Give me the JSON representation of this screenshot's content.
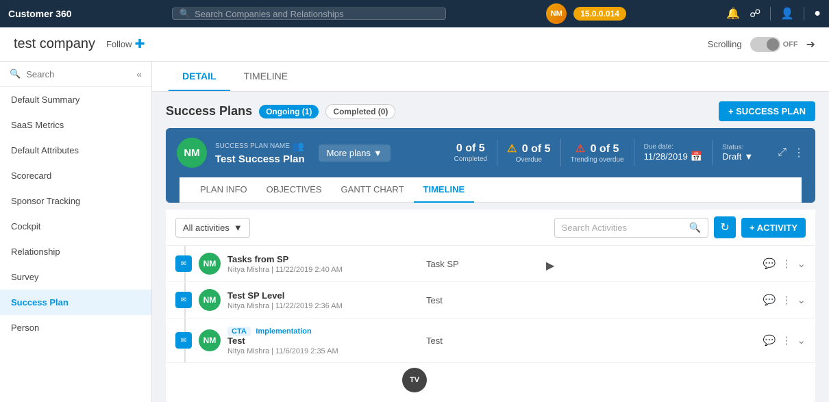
{
  "topNav": {
    "brand": "Customer 360",
    "searchPlaceholder": "Search Companies and Relationships",
    "version": "15.0.0.014",
    "avatarInitials": "NM"
  },
  "subHeader": {
    "companyName": "test company",
    "followLabel": "Follow",
    "scrollingLabel": "Scrolling",
    "scrollingState": "OFF"
  },
  "tabs": {
    "detail": "DETAIL",
    "timeline": "TIMELINE"
  },
  "sidebar": {
    "searchPlaceholder": "Search",
    "items": [
      {
        "label": "Default Summary",
        "active": false
      },
      {
        "label": "SaaS Metrics",
        "active": false
      },
      {
        "label": "Default Attributes",
        "active": false
      },
      {
        "label": "Scorecard",
        "active": false
      },
      {
        "label": "Sponsor Tracking",
        "active": false
      },
      {
        "label": "Cockpit",
        "active": false
      },
      {
        "label": "Relationship",
        "active": false
      },
      {
        "label": "Survey",
        "active": false
      },
      {
        "label": "Success Plan",
        "active": true
      },
      {
        "label": "Person",
        "active": false
      }
    ]
  },
  "successPlans": {
    "title": "Success Plans",
    "ongoingLabel": "Ongoing (1)",
    "completedLabel": "Completed (0)",
    "addBtnLabel": "+ SUCCESS PLAN"
  },
  "planCard": {
    "avatarInitials": "NM",
    "planNameLabel": "SUCCESS PLAN NAME",
    "planName": "Test Success Plan",
    "morePlansLabel": "More plans",
    "stats": {
      "completed": {
        "value": "0 of 5",
        "label": "Completed"
      },
      "overdue": {
        "value": "0 of 5",
        "label": "Overdue"
      },
      "trendingOverdue": {
        "value": "0 of 5",
        "label": "Trending overdue"
      }
    },
    "dueDate": {
      "label": "Due date:",
      "value": "11/28/2019"
    },
    "status": {
      "label": "Status:",
      "value": "Draft"
    }
  },
  "planSubtabs": {
    "items": [
      "PLAN INFO",
      "OBJECTIVES",
      "GANTT CHART",
      "TIMELINE"
    ],
    "active": "TIMELINE"
  },
  "timeline": {
    "filterLabel": "All activities",
    "searchPlaceholder": "Search Activities",
    "addActivityLabel": "+ ACTIVITY",
    "activities": [
      {
        "title": "Tasks from SP",
        "meta": "Nitya Mishra  |  11/22/2019 2:40 AM",
        "content": "Task SP",
        "ctaBadge": null,
        "implBadge": null
      },
      {
        "title": "Test SP Level",
        "meta": "Nitya Mishra  |  11/22/2019 2:36 AM",
        "content": "Test",
        "ctaBadge": null,
        "implBadge": null
      },
      {
        "title": "Test",
        "meta": "Nitya Mishra  |  11/6/2019 2:35 AM",
        "content": "Test",
        "ctaBadge": "CTA",
        "implBadge": "Implementation"
      }
    ]
  },
  "bottomAvatar": "TV"
}
